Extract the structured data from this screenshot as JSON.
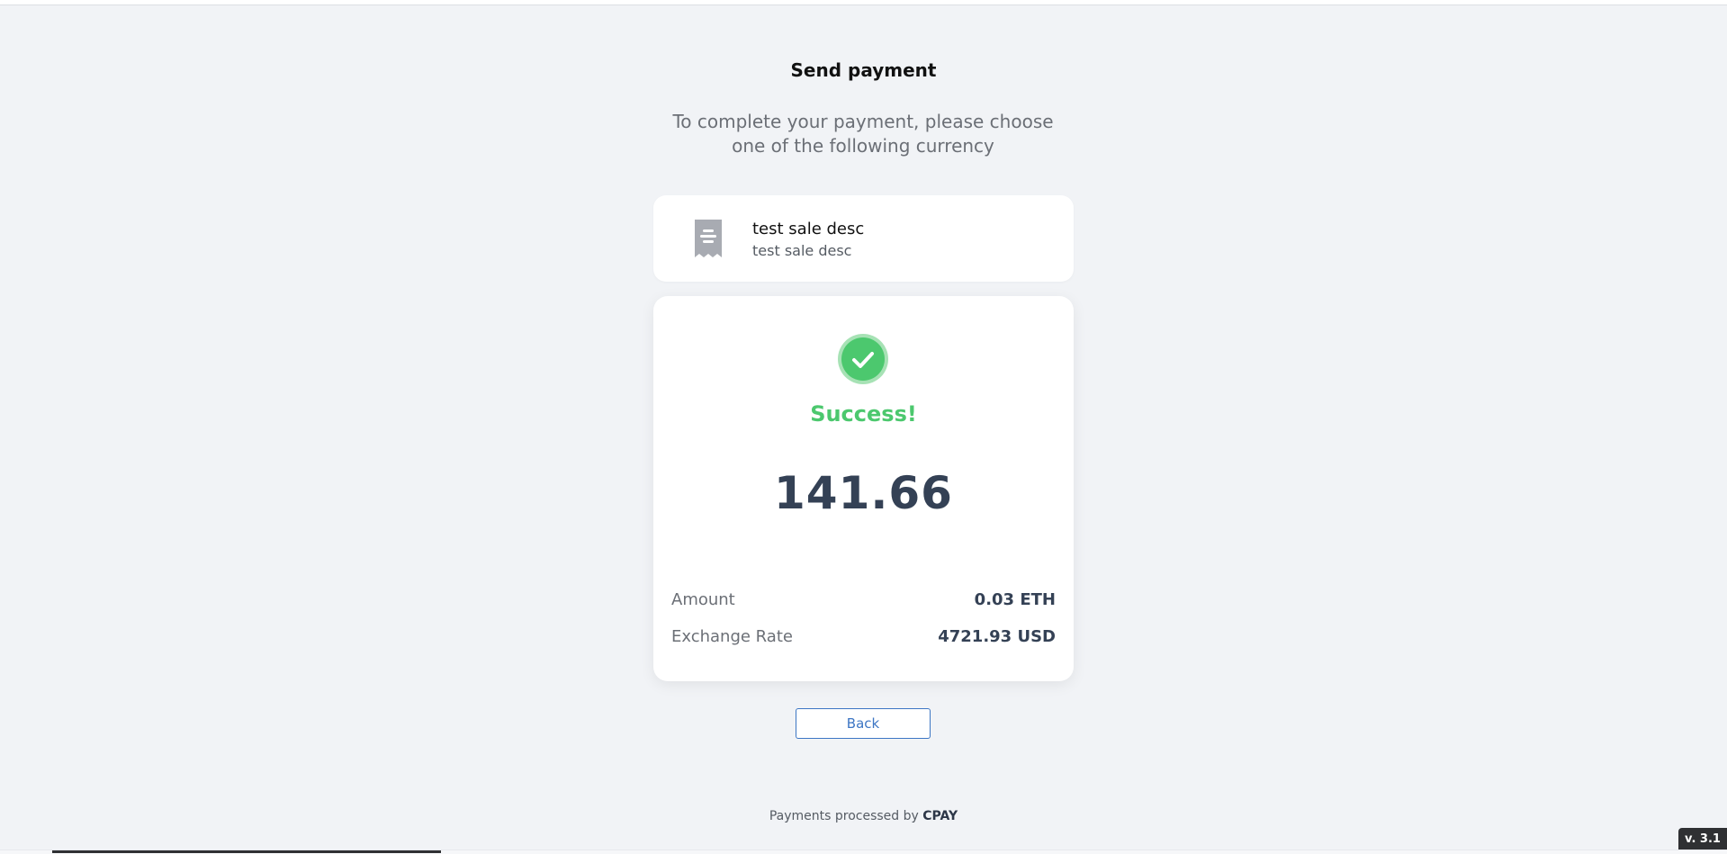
{
  "header": {
    "title": "Send payment",
    "subtitle": "To complete your payment, please choose one of the following currency"
  },
  "invoice": {
    "title": "test sale desc",
    "description": "test sale desc",
    "icon": "receipt-icon"
  },
  "result": {
    "icon": "check-circle-icon",
    "status": "Success!",
    "fiat_amount": "141.66",
    "details": {
      "amount_label": "Amount",
      "amount_value": "0.03 ETH",
      "rate_label": "Exchange Rate",
      "rate_value": "4721.93 USD"
    }
  },
  "actions": {
    "back_label": "Back"
  },
  "footer": {
    "prefix": "Payments processed by",
    "brand": "CPAY"
  },
  "version": "v. 3.1",
  "colors": {
    "background": "#f1f3f6",
    "success": "#4cc86e",
    "accent": "#3d76c4",
    "amount_text": "#344155"
  }
}
